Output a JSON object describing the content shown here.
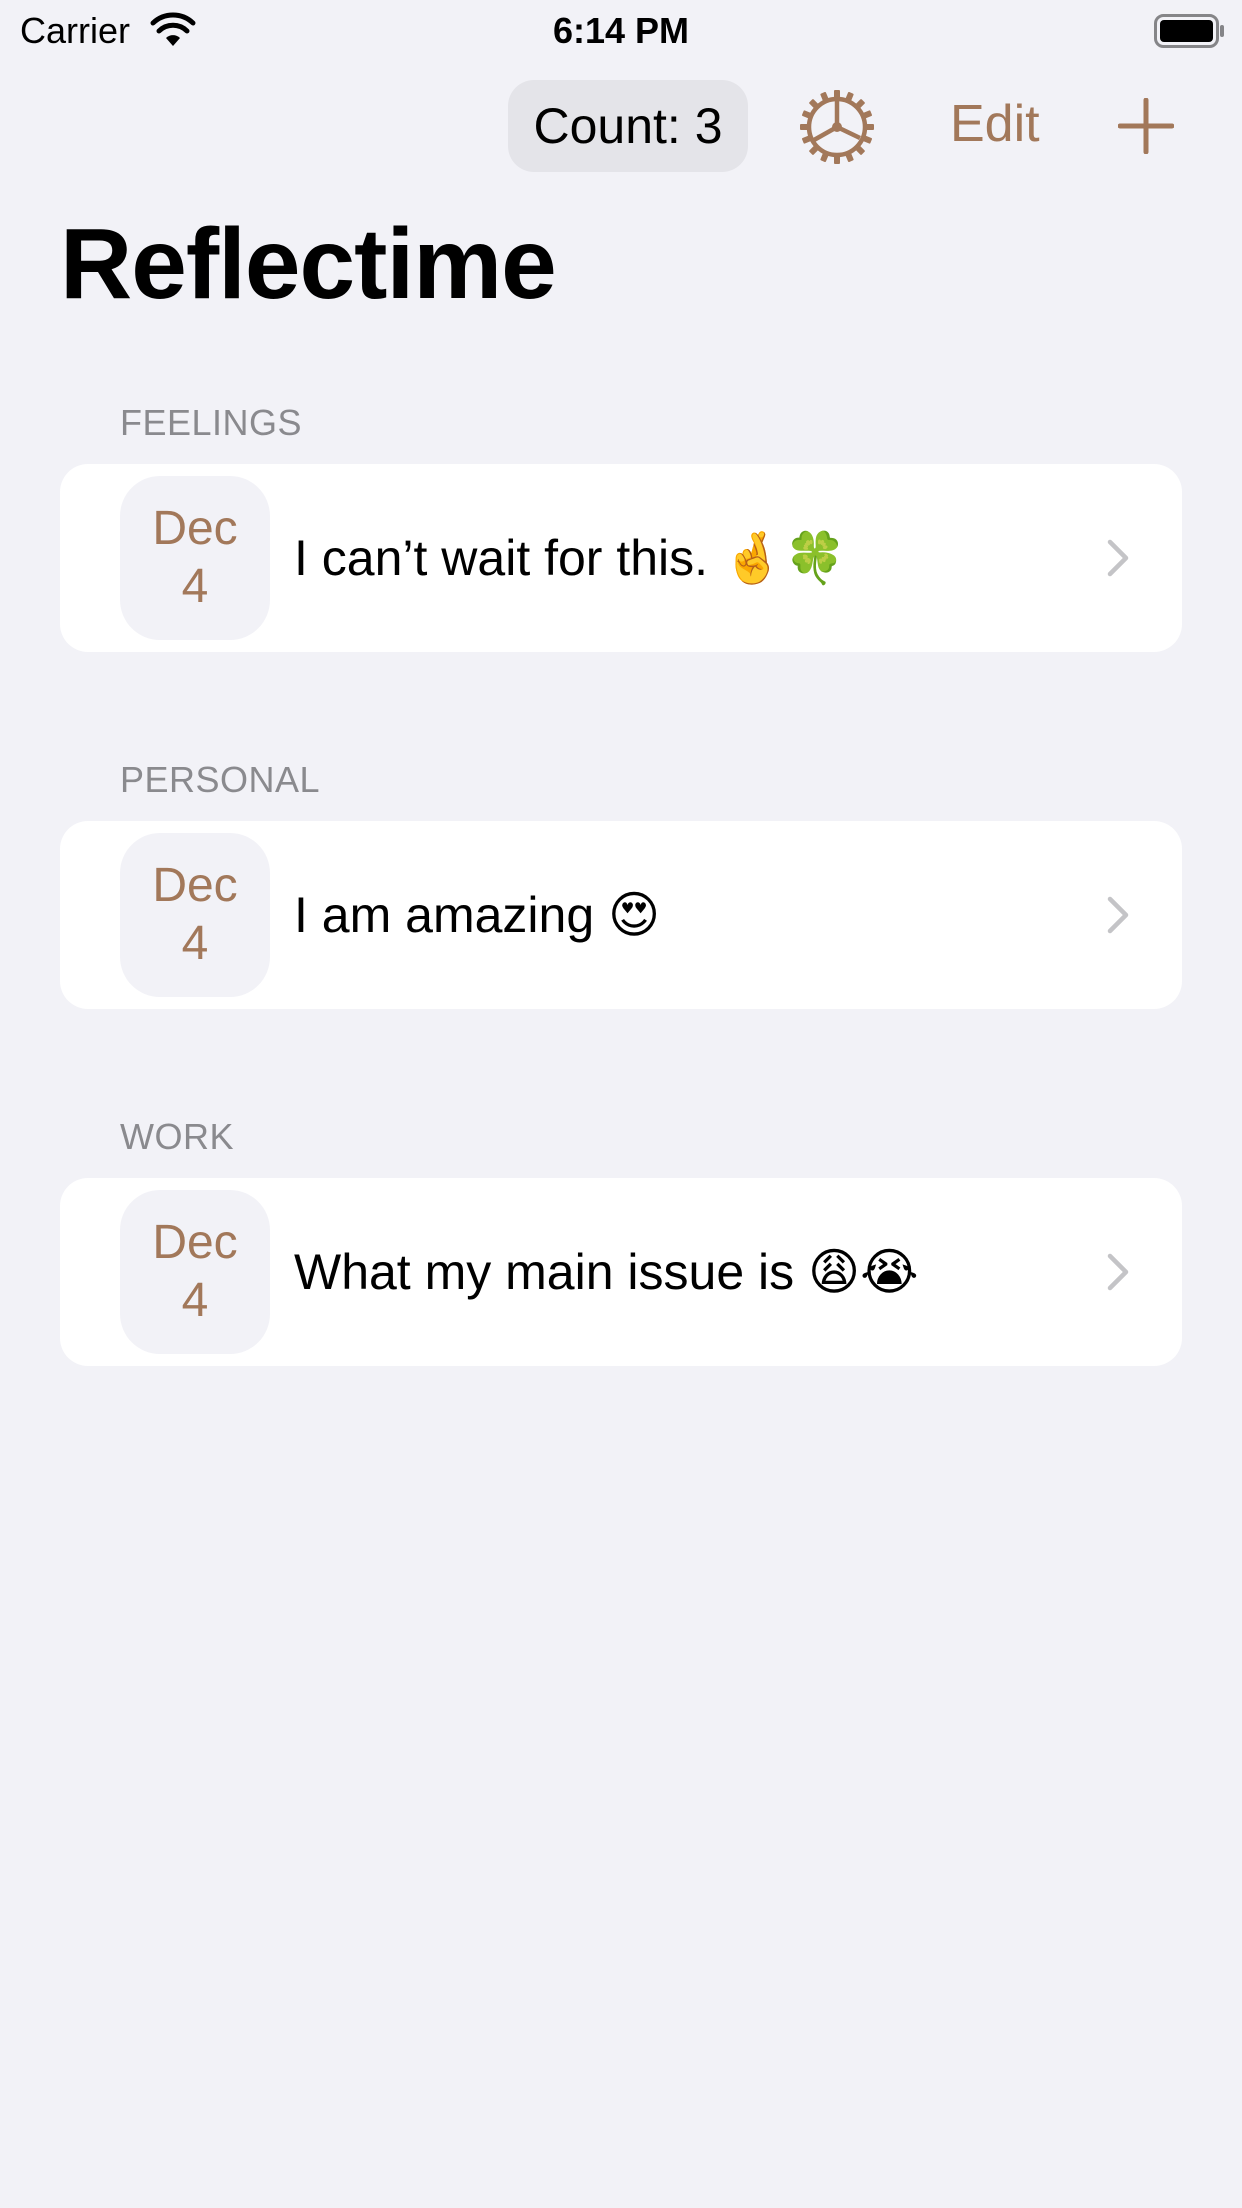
{
  "status_bar": {
    "carrier": "Carrier",
    "time": "6:14 PM"
  },
  "toolbar": {
    "count_label": "Count: 3",
    "edit_label": "Edit",
    "accent_color": "#a2785a"
  },
  "page_title": "Reflectime",
  "sections": [
    {
      "header": "FEELINGS",
      "entry": {
        "date_month": "Dec",
        "date_day": "4",
        "text": "I can’t wait for this. 🤞🍀"
      }
    },
    {
      "header": "PERSONAL",
      "entry": {
        "date_month": "Dec",
        "date_day": "4",
        "text": "I am amazing 😍"
      }
    },
    {
      "header": "WORK",
      "entry": {
        "date_month": "Dec",
        "date_day": "4",
        "text": "What my main issue is 😩😭"
      }
    }
  ],
  "icons": {
    "settings": "gear-icon",
    "add": "plus-icon",
    "disclosure": "chevron-right-icon",
    "wifi": "wifi-icon",
    "battery": "battery-icon"
  }
}
